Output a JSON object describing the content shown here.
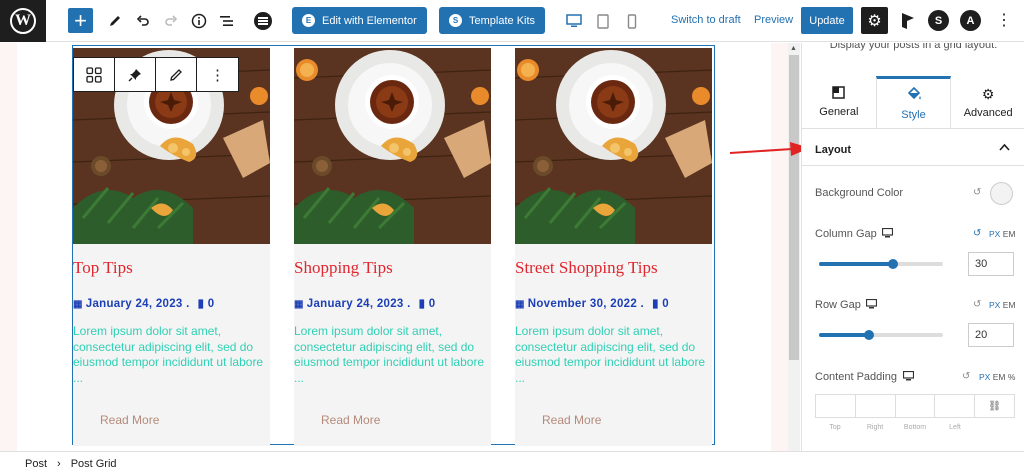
{
  "toolbar": {
    "edit_elementor": "Edit with Elementor",
    "template_kits": "Template Kits",
    "switch_to_draft": "Switch to draft",
    "preview": "Preview",
    "update": "Update"
  },
  "posts": [
    {
      "title": "Top Tips",
      "date": "January 24, 2023",
      "comments": "0",
      "excerpt": "Lorem ipsum dolor sit amet, consectetur adipiscing elit, sed do eiusmod tempor incididunt ut labore ...",
      "read_more": "Read More"
    },
    {
      "title": "Shopping Tips",
      "date": "January 24, 2023",
      "comments": "0",
      "excerpt": "Lorem ipsum dolor sit amet, consectetur adipiscing elit, sed do eiusmod tempor incididunt ut labore ...",
      "read_more": "Read More"
    },
    {
      "title": "Street Shopping Tips",
      "date": "November 30, 2022",
      "comments": "0",
      "excerpt": "Lorem ipsum dolor sit amet, consectetur adipiscing elit, sed do eiusmod tempor incididunt ut labore ...",
      "read_more": "Read More"
    }
  ],
  "sidebar": {
    "description": "Display your posts in a grid layout.",
    "tabs": [
      {
        "label": "General",
        "icon": "layout-icon"
      },
      {
        "label": "Style",
        "icon": "paint-bucket-icon"
      },
      {
        "label": "Advanced",
        "icon": "gear-icon"
      }
    ],
    "section_title": "Layout",
    "background_color_label": "Background Color",
    "column_gap": {
      "label": "Column Gap",
      "value": "30",
      "units": [
        "PX",
        "EM"
      ],
      "slider_fraction": 0.6
    },
    "row_gap": {
      "label": "Row Gap",
      "value": "20",
      "units": [
        "PX",
        "EM"
      ],
      "slider_fraction": 0.4
    },
    "content_padding": {
      "label": "Content Padding",
      "units": [
        "PX",
        "EM",
        "%"
      ],
      "sides": [
        "Top",
        "Right",
        "Bottom",
        "Left"
      ]
    }
  },
  "breadcrumb": {
    "items": [
      "Post",
      "Post Grid"
    ]
  },
  "colors": {
    "accent": "#2271b1",
    "title_red": "#e0262e",
    "meta_blue": "#1d3fb5",
    "excerpt_teal": "#2fd0b5"
  }
}
